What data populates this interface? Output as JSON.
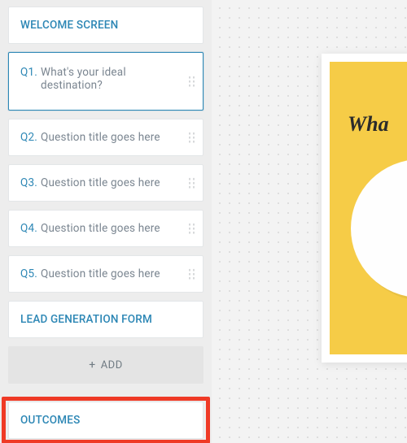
{
  "sidebar": {
    "welcome_label": "WELCOME SCREEN",
    "questions": [
      {
        "label": "Q1.",
        "title": "What's your ideal destination?",
        "selected": true
      },
      {
        "label": "Q2.",
        "title": "Question title goes here",
        "selected": false
      },
      {
        "label": "Q3.",
        "title": "Question title goes here",
        "selected": false
      },
      {
        "label": "Q4.",
        "title": "Question title goes here",
        "selected": false
      },
      {
        "label": "Q5.",
        "title": "Question title goes here",
        "selected": false
      }
    ],
    "lead_form_label": "LEAD GENERATION FORM",
    "add_label": "ADD",
    "outcomes_label": "OUTCOMES"
  },
  "preview": {
    "title_fragment": "Wha"
  },
  "colors": {
    "accent": "#2d87b5",
    "highlight": "#ef3a26",
    "preview_bg": "#f6cc47"
  }
}
